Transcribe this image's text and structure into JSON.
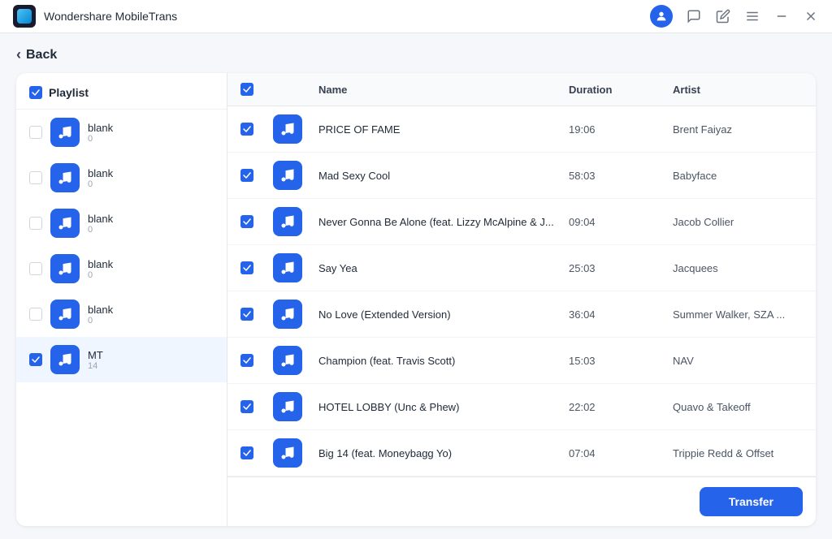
{
  "titlebar": {
    "app_name": "Wondershare MobileTrans",
    "controls": [
      "user",
      "speech-bubble",
      "edit",
      "menu",
      "minimize",
      "close"
    ]
  },
  "back_button": {
    "label": "Back"
  },
  "sidebar": {
    "header": "Playlist",
    "items": [
      {
        "id": 1,
        "name": "blank",
        "count": "0",
        "checked": false
      },
      {
        "id": 2,
        "name": "blank",
        "count": "0",
        "checked": false
      },
      {
        "id": 3,
        "name": "blank",
        "count": "0",
        "checked": false
      },
      {
        "id": 4,
        "name": "blank",
        "count": "0",
        "checked": false
      },
      {
        "id": 5,
        "name": "blank",
        "count": "0",
        "checked": false
      },
      {
        "id": 6,
        "name": "MT",
        "count": "14",
        "checked": true,
        "active": true
      }
    ]
  },
  "table": {
    "columns": [
      "Name",
      "Duration",
      "Artist"
    ],
    "rows": [
      {
        "name": "PRICE OF FAME",
        "duration": "19:06",
        "artist": "Brent Faiyaz",
        "checked": true
      },
      {
        "name": "Mad Sexy Cool",
        "duration": "58:03",
        "artist": "Babyface",
        "checked": true
      },
      {
        "name": "Never Gonna Be Alone (feat. Lizzy McAlpine & J...",
        "duration": "09:04",
        "artist": "Jacob Collier",
        "checked": true
      },
      {
        "name": "Say Yea",
        "duration": "25:03",
        "artist": "Jacquees",
        "checked": true
      },
      {
        "name": "No Love (Extended Version)",
        "duration": "36:04",
        "artist": "Summer Walker, SZA ...",
        "checked": true
      },
      {
        "name": "Champion (feat. Travis Scott)",
        "duration": "15:03",
        "artist": "NAV",
        "checked": true
      },
      {
        "name": "HOTEL LOBBY (Unc & Phew)",
        "duration": "22:02",
        "artist": "Quavo & Takeoff",
        "checked": true
      },
      {
        "name": "Big 14 (feat. Moneybagg Yo)",
        "duration": "07:04",
        "artist": "Trippie Redd & Offset",
        "checked": true
      }
    ]
  },
  "footer": {
    "transfer_label": "Transfer"
  }
}
